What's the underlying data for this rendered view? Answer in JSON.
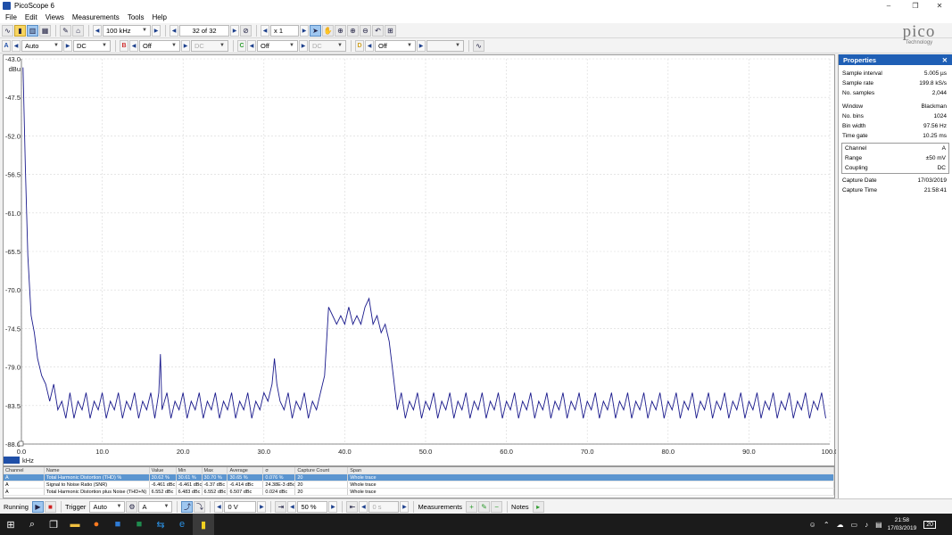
{
  "window": {
    "title": "PicoScope 6",
    "minimize": "–",
    "restore": "❐",
    "close": "✕"
  },
  "menu": [
    "File",
    "Edit",
    "Views",
    "Measurements",
    "Tools",
    "Help"
  ],
  "toolbar": {
    "timebase": "100 kHz",
    "buffer": "32 of 32",
    "zoom": "x 1"
  },
  "channels": [
    {
      "letter": "A",
      "range": "Auto",
      "coupling": "DC",
      "color": "#1f4fa8"
    },
    {
      "letter": "B",
      "range": "Off",
      "coupling": "DC",
      "color": "#d03030"
    },
    {
      "letter": "C",
      "range": "Off",
      "coupling": "DC",
      "color": "#2e9c2e"
    },
    {
      "letter": "D",
      "range": "Off",
      "coupling": "",
      "color": "#d0a020"
    }
  ],
  "logo": {
    "name": "pico",
    "sub": "Technology"
  },
  "chart_data": {
    "type": "line",
    "xlabel": "kHz",
    "ylabel": "dBu",
    "xlim": [
      0,
      100
    ],
    "ylim": [
      -88,
      -43
    ],
    "xticks": [
      "0.0",
      "10.0",
      "20.0",
      "30.0",
      "40.0",
      "50.0",
      "60.0",
      "70.0",
      "80.0",
      "90.0",
      "100.0"
    ],
    "yticks": [
      "-43.0",
      "-47.5",
      "-52.0",
      "-56.5",
      "-61.0",
      "-65.5",
      "-70.0",
      "-74.5",
      "-79.0",
      "-83.5",
      "-88.0"
    ],
    "grid": true,
    "series": [
      {
        "color": "#1a1a8c",
        "points": [
          [
            0.2,
            -44
          ],
          [
            0.5,
            -56
          ],
          [
            0.8,
            -66
          ],
          [
            1.2,
            -73
          ],
          [
            1.6,
            -75
          ],
          [
            2,
            -78
          ],
          [
            2.5,
            -80
          ],
          [
            3,
            -81
          ],
          [
            3.5,
            -83
          ],
          [
            4,
            -81
          ],
          [
            4.5,
            -84
          ],
          [
            5,
            -83
          ],
          [
            5.5,
            -85
          ],
          [
            6,
            -82
          ],
          [
            6.5,
            -85
          ],
          [
            7,
            -83
          ],
          [
            7.5,
            -84
          ],
          [
            8,
            -82
          ],
          [
            8.5,
            -85
          ],
          [
            9,
            -83
          ],
          [
            9.5,
            -84
          ],
          [
            10,
            -82
          ],
          [
            10.5,
            -85
          ],
          [
            11,
            -83
          ],
          [
            11.5,
            -84
          ],
          [
            12,
            -82
          ],
          [
            12.5,
            -85
          ],
          [
            13,
            -83
          ],
          [
            13.5,
            -84
          ],
          [
            14,
            -82
          ],
          [
            14.5,
            -85
          ],
          [
            15,
            -83
          ],
          [
            15.5,
            -84
          ],
          [
            16,
            -82
          ],
          [
            16.5,
            -85
          ],
          [
            17,
            -82
          ],
          [
            17.2,
            -77.5
          ],
          [
            17.4,
            -84
          ],
          [
            18,
            -82
          ],
          [
            18.5,
            -85
          ],
          [
            19,
            -83
          ],
          [
            19.5,
            -84
          ],
          [
            20,
            -82
          ],
          [
            20.5,
            -85
          ],
          [
            21,
            -83
          ],
          [
            21.5,
            -84
          ],
          [
            22,
            -82
          ],
          [
            22.5,
            -85
          ],
          [
            23,
            -83
          ],
          [
            23.5,
            -84
          ],
          [
            24,
            -82
          ],
          [
            24.5,
            -85
          ],
          [
            25,
            -83
          ],
          [
            25.5,
            -84
          ],
          [
            26,
            -82
          ],
          [
            26.5,
            -85
          ],
          [
            27,
            -83
          ],
          [
            27.5,
            -84
          ],
          [
            28,
            -82
          ],
          [
            28.5,
            -85
          ],
          [
            29,
            -83
          ],
          [
            29.5,
            -84
          ],
          [
            30,
            -82
          ],
          [
            30.5,
            -83
          ],
          [
            31,
            -81
          ],
          [
            31.3,
            -78
          ],
          [
            31.6,
            -81
          ],
          [
            32,
            -83
          ],
          [
            32.5,
            -84
          ],
          [
            33,
            -82
          ],
          [
            33.5,
            -85
          ],
          [
            34,
            -83
          ],
          [
            34.5,
            -84
          ],
          [
            35,
            -82
          ],
          [
            35.5,
            -85
          ],
          [
            36,
            -83
          ],
          [
            36.5,
            -84
          ],
          [
            37,
            -82
          ],
          [
            37.5,
            -80
          ],
          [
            38,
            -72
          ],
          [
            38.5,
            -73
          ],
          [
            39,
            -74
          ],
          [
            39.5,
            -73
          ],
          [
            40,
            -74
          ],
          [
            40.5,
            -72
          ],
          [
            41,
            -74
          ],
          [
            41.5,
            -73
          ],
          [
            42,
            -74
          ],
          [
            42.5,
            -72
          ],
          [
            43,
            -71
          ],
          [
            43.5,
            -74
          ],
          [
            44,
            -73
          ],
          [
            44.5,
            -75
          ],
          [
            45,
            -74
          ],
          [
            45.5,
            -76
          ],
          [
            46,
            -80
          ],
          [
            46.5,
            -84
          ],
          [
            47,
            -82
          ],
          [
            47.5,
            -85
          ],
          [
            48,
            -83
          ],
          [
            48.5,
            -84
          ],
          [
            49,
            -82
          ],
          [
            49.5,
            -85
          ],
          [
            50,
            -83
          ],
          [
            50.5,
            -84
          ],
          [
            51,
            -82
          ],
          [
            51.5,
            -85
          ],
          [
            52,
            -83
          ],
          [
            52.5,
            -84
          ],
          [
            53,
            -82
          ],
          [
            53.5,
            -85
          ],
          [
            54,
            -83
          ],
          [
            54.5,
            -84
          ],
          [
            55,
            -82
          ],
          [
            55.5,
            -85
          ],
          [
            56,
            -83
          ],
          [
            56.5,
            -84
          ],
          [
            57,
            -82
          ],
          [
            57.5,
            -85
          ],
          [
            58,
            -83
          ],
          [
            58.5,
            -84
          ],
          [
            59,
            -82
          ],
          [
            59.5,
            -85
          ],
          [
            60,
            -83
          ],
          [
            60.5,
            -84
          ],
          [
            61,
            -82
          ],
          [
            61.5,
            -85
          ],
          [
            62,
            -83
          ],
          [
            62.5,
            -84
          ],
          [
            63,
            -82
          ],
          [
            63.5,
            -85
          ],
          [
            64,
            -83
          ],
          [
            64.5,
            -84
          ],
          [
            65,
            -82
          ],
          [
            65.5,
            -85
          ],
          [
            66,
            -83
          ],
          [
            66.5,
            -84
          ],
          [
            67,
            -82
          ],
          [
            67.5,
            -85
          ],
          [
            68,
            -83
          ],
          [
            68.5,
            -84
          ],
          [
            69,
            -82
          ],
          [
            69.5,
            -85
          ],
          [
            70,
            -83
          ],
          [
            70.5,
            -84
          ],
          [
            71,
            -82
          ],
          [
            71.5,
            -85
          ],
          [
            72,
            -83
          ],
          [
            72.5,
            -84
          ],
          [
            73,
            -82
          ],
          [
            73.5,
            -85
          ],
          [
            74,
            -83
          ],
          [
            74.5,
            -84
          ],
          [
            75,
            -82
          ],
          [
            75.5,
            -85
          ],
          [
            76,
            -83
          ],
          [
            76.5,
            -84
          ],
          [
            77,
            -82
          ],
          [
            77.5,
            -85
          ],
          [
            78,
            -83
          ],
          [
            78.5,
            -84
          ],
          [
            79,
            -82
          ],
          [
            79.5,
            -85
          ],
          [
            80,
            -83
          ],
          [
            80.5,
            -84
          ],
          [
            81,
            -82
          ],
          [
            81.5,
            -85
          ],
          [
            82,
            -83
          ],
          [
            82.5,
            -84
          ],
          [
            83,
            -82
          ],
          [
            83.5,
            -85
          ],
          [
            84,
            -83
          ],
          [
            84.5,
            -84
          ],
          [
            85,
            -82
          ],
          [
            85.5,
            -85
          ],
          [
            86,
            -83
          ],
          [
            86.5,
            -84
          ],
          [
            87,
            -82
          ],
          [
            87.5,
            -85
          ],
          [
            88,
            -83
          ],
          [
            88.5,
            -84
          ],
          [
            89,
            -82
          ],
          [
            89.5,
            -85
          ],
          [
            90,
            -83
          ],
          [
            90.5,
            -84
          ],
          [
            91,
            -82
          ],
          [
            91.5,
            -85
          ],
          [
            92,
            -83
          ],
          [
            92.5,
            -84
          ],
          [
            93,
            -82
          ],
          [
            93.5,
            -85
          ],
          [
            94,
            -83
          ],
          [
            94.5,
            -84
          ],
          [
            95,
            -82
          ],
          [
            95.5,
            -85
          ],
          [
            96,
            -83
          ],
          [
            96.5,
            -84
          ],
          [
            97,
            -82
          ],
          [
            97.5,
            -85
          ],
          [
            98,
            -83
          ],
          [
            98.5,
            -84
          ],
          [
            99,
            -82
          ],
          [
            99.5,
            -85
          ]
        ]
      }
    ]
  },
  "properties": {
    "title": "Properties",
    "group1": [
      {
        "label": "Sample interval",
        "value": "5.005 µs"
      },
      {
        "label": "Sample rate",
        "value": "199.8 kS/s"
      },
      {
        "label": "No. samples",
        "value": "2,044"
      }
    ],
    "group2": [
      {
        "label": "Window",
        "value": "Blackman"
      },
      {
        "label": "No. bins",
        "value": "1024"
      },
      {
        "label": "Bin width",
        "value": "97.56 Hz"
      },
      {
        "label": "Time gate",
        "value": "10.25 ms"
      }
    ],
    "channel_box": [
      {
        "label": "Channel",
        "value": "A"
      },
      {
        "label": "Range",
        "value": "±50 mV"
      },
      {
        "label": "Coupling",
        "value": "DC"
      }
    ],
    "group3": [
      {
        "label": "Capture Date",
        "value": "17/03/2019"
      },
      {
        "label": "Capture Time",
        "value": "21:58:41"
      }
    ]
  },
  "measurements": {
    "columns": [
      "Channel",
      "Name",
      "Value",
      "Min",
      "Max",
      "Average",
      "σ",
      "Capture Count",
      "Span"
    ],
    "rows": [
      [
        "A",
        "Total Harmonic Distortion (THD) %",
        "30.62 %",
        "30.61 %",
        "30.70 %",
        "30.65 %",
        "0.076 %",
        "20",
        "Whole trace"
      ],
      [
        "A",
        "Signal to Noise Ratio (SNR)",
        "-6.461 dBc",
        "-6.461 dBc",
        "-6.37 dBc",
        "-6.414 dBc",
        "24.38E-3 dBc",
        "20",
        "Whole trace"
      ],
      [
        "A",
        "Total Harmonic Distortion plus Noise (THD+N)",
        "6.552 dBc",
        "6.483 dBc",
        "6.552 dBc",
        "6.507 dBc",
        "0.024 dBc",
        "20",
        "Whole trace"
      ]
    ]
  },
  "bottom": {
    "running": "Running",
    "trigger": "Trigger",
    "trigger_mode": "Auto",
    "trigger_channel": "A",
    "trigger_level": "0 V",
    "pre_trigger": "50 %",
    "delay": "0 s",
    "measurements": "Measurements",
    "notes": "Notes"
  },
  "taskbar": {
    "time": "21:58",
    "date": "17/03/2019",
    "notif": "20"
  }
}
